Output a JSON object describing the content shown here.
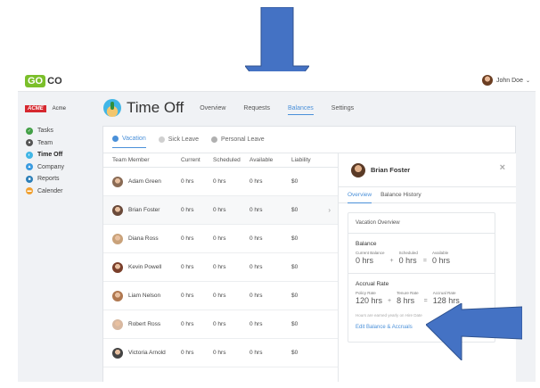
{
  "colors": {
    "accent": "#4a90d9",
    "arrow": "#4472c4",
    "logo_green": "#7bbf2a",
    "brand_red": "#d6282f"
  },
  "topbar": {
    "logo_go": "GO",
    "logo_co": "CO",
    "user_name": "John Doe",
    "user_menu_icon": "chevron-down-icon",
    "user_chevron": "⌄"
  },
  "sidebar": {
    "company_logo_text": "ACME",
    "company_name": "Acme",
    "items": [
      {
        "label": "Tasks",
        "icon": "check-circle-icon",
        "color": "#43a047",
        "glyph": "✓"
      },
      {
        "label": "Team",
        "icon": "team-icon",
        "color": "#555555",
        "glyph": "●"
      },
      {
        "label": "Time Off",
        "icon": "beach-icon",
        "color": "#41b6e6",
        "glyph": "◐",
        "active": true
      },
      {
        "label": "Company",
        "icon": "building-icon",
        "color": "#3a9be0",
        "glyph": "▲"
      },
      {
        "label": "Reports",
        "icon": "reports-icon",
        "color": "#2c7fb8",
        "glyph": "■"
      },
      {
        "label": "Calender",
        "icon": "calendar-icon",
        "color": "#f0a030",
        "glyph": "▬"
      }
    ]
  },
  "header": {
    "title": "Time Off",
    "tabs": [
      "Overview",
      "Requests",
      "Balances",
      "Settings"
    ],
    "active_tab": "Balances"
  },
  "leave_tabs": [
    {
      "label": "Vacation",
      "icon": "vacation-icon",
      "color": "#4a90d9",
      "active": true
    },
    {
      "label": "Sick Leave",
      "icon": "sick-leave-icon",
      "color": "#d0d0d0"
    },
    {
      "label": "Personal Leave",
      "icon": "personal-leave-icon",
      "color": "#b0b0b0"
    }
  ],
  "table": {
    "columns": [
      "Team Member",
      "Current",
      "Scheduled",
      "Available",
      "Liability"
    ],
    "rows": [
      {
        "name": "Adam Green",
        "current": "0 hrs",
        "scheduled": "0 hrs",
        "available": "0 hrs",
        "liability": "$0"
      },
      {
        "name": "Brian Foster",
        "current": "0 hrs",
        "scheduled": "0 hrs",
        "available": "0 hrs",
        "liability": "$0",
        "selected": true
      },
      {
        "name": "Diana Ross",
        "current": "0 hrs",
        "scheduled": "0 hrs",
        "available": "0 hrs",
        "liability": "$0"
      },
      {
        "name": "Kevin Powell",
        "current": "0 hrs",
        "scheduled": "0 hrs",
        "available": "0 hrs",
        "liability": "$0"
      },
      {
        "name": "Liam Nelson",
        "current": "0 hrs",
        "scheduled": "0 hrs",
        "available": "0 hrs",
        "liability": "$0"
      },
      {
        "name": "Robert Ross",
        "current": "0 hrs",
        "scheduled": "0 hrs",
        "available": "0 hrs",
        "liability": "$0"
      },
      {
        "name": "Victoria Arnold",
        "current": "0 hrs",
        "scheduled": "0 hrs",
        "available": "0 hrs",
        "liability": "$0"
      }
    ],
    "row_chevron": "›"
  },
  "panel": {
    "name": "Brian Foster",
    "close_glyph": "×",
    "tabs": [
      "Overview",
      "Balance History"
    ],
    "active_tab": "Overview",
    "overview_title": "Vacation Overview",
    "balance": {
      "label": "Balance",
      "current_label": "Current Balance",
      "current_value": "0 hrs",
      "scheduled_label": "Scheduled",
      "scheduled_value": "0 hrs",
      "available_label": "Available",
      "available_value": "0 hrs",
      "op_plus": "+",
      "op_equals": "="
    },
    "accrual": {
      "label": "Accrual Rate",
      "policy_label": "Policy Rate",
      "policy_value": "120 hrs",
      "tenure_label": "Tenure Rate",
      "tenure_value": "8 hrs",
      "accrual_label": "Accrual Rate",
      "accrual_value": "128 hrs",
      "op_plus": "+",
      "op_equals": "="
    },
    "note": "Hours are earned yearly on Hire Date",
    "edit_link": "Edit Balance & Accruals"
  }
}
